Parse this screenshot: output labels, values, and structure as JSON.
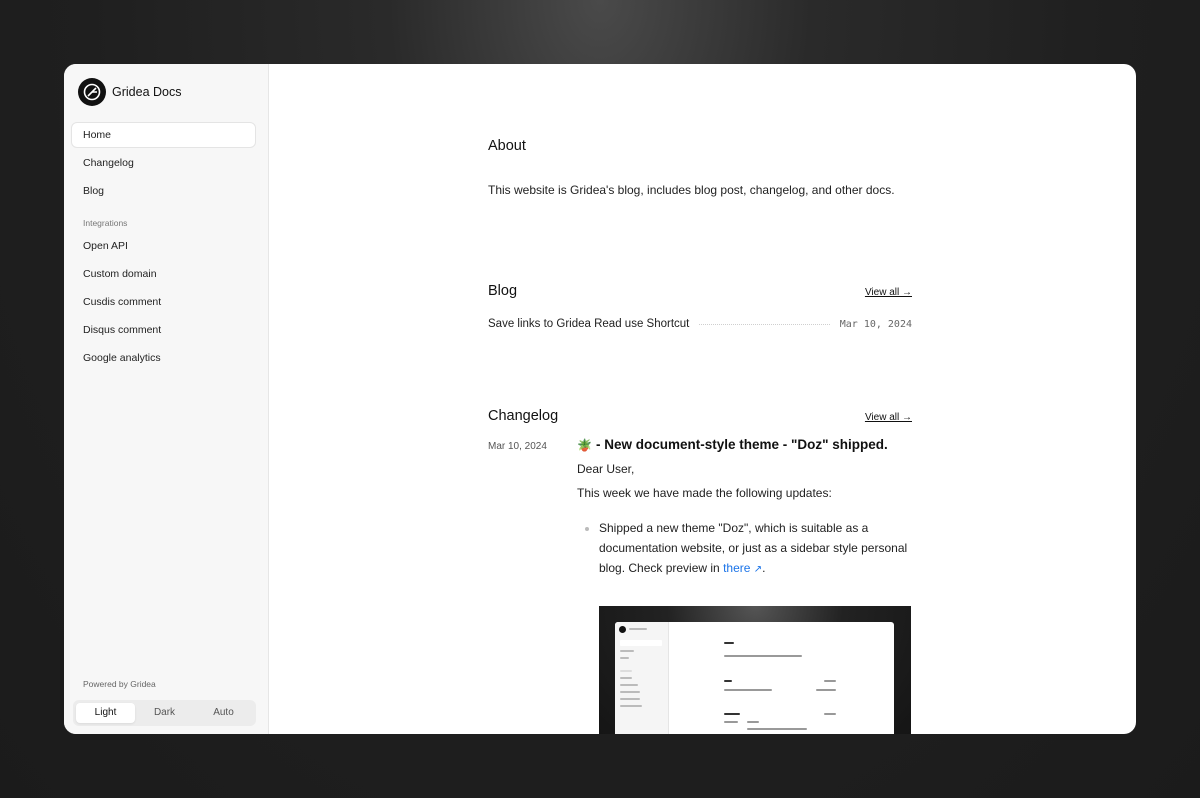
{
  "sidebar": {
    "brand": "Gridea Docs",
    "items": [
      {
        "label": "Home"
      },
      {
        "label": "Changelog"
      },
      {
        "label": "Blog"
      }
    ],
    "section_label": "Integrations",
    "integrations": [
      {
        "label": "Open API"
      },
      {
        "label": "Custom domain"
      },
      {
        "label": "Cusdis comment"
      },
      {
        "label": "Disqus comment"
      },
      {
        "label": "Google analytics"
      }
    ],
    "powered_by": "Powered by Gridea",
    "theme": {
      "options": [
        "Light",
        "Dark",
        "Auto"
      ],
      "selected": "Light"
    }
  },
  "about": {
    "title": "About",
    "text": "This website is Gridea's blog, includes blog post, changelog, and other docs."
  },
  "blog": {
    "title": "Blog",
    "view_all": "View all →",
    "posts": [
      {
        "title": "Save links to Gridea Read use Shortcut",
        "date": "Mar 10, 2024"
      }
    ]
  },
  "changelog": {
    "title": "Changelog",
    "view_all": "View all →",
    "entry": {
      "date": "Mar 10, 2024",
      "emoji": "🪴",
      "title": "- New document-style theme - \"Doz\" shipped.",
      "greeting": "Dear User,",
      "intro": "This week we have made the following updates:",
      "bullet_text": "Shipped a new theme \"Doz\", which is suitable as a documentation website, or just as a sidebar style personal blog. Check preview in",
      "link_text": "there",
      "link_suffix": "↗",
      "bullet_end": "."
    }
  }
}
